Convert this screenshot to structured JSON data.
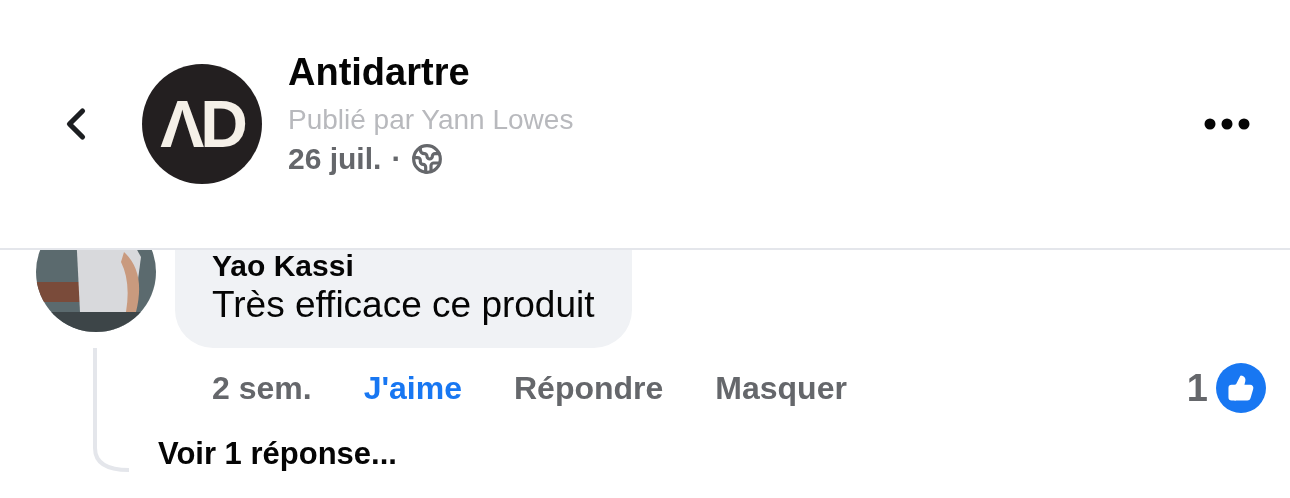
{
  "header": {
    "page_name": "Antidartre",
    "avatar_text": "ΛD",
    "posted_by": "Publié par Yann Lowes",
    "date": "26 juil.",
    "separator": "·"
  },
  "comment": {
    "author": "Yao Kassi",
    "text": "Très efficace ce produit",
    "time": "2 sem.",
    "actions": [
      {
        "label": "J'aime",
        "selected": true
      },
      {
        "label": "Répondre",
        "selected": false
      },
      {
        "label": "Masquer",
        "selected": false
      }
    ],
    "reaction_count": "1",
    "replies_link": "Voir 1 réponse..."
  }
}
